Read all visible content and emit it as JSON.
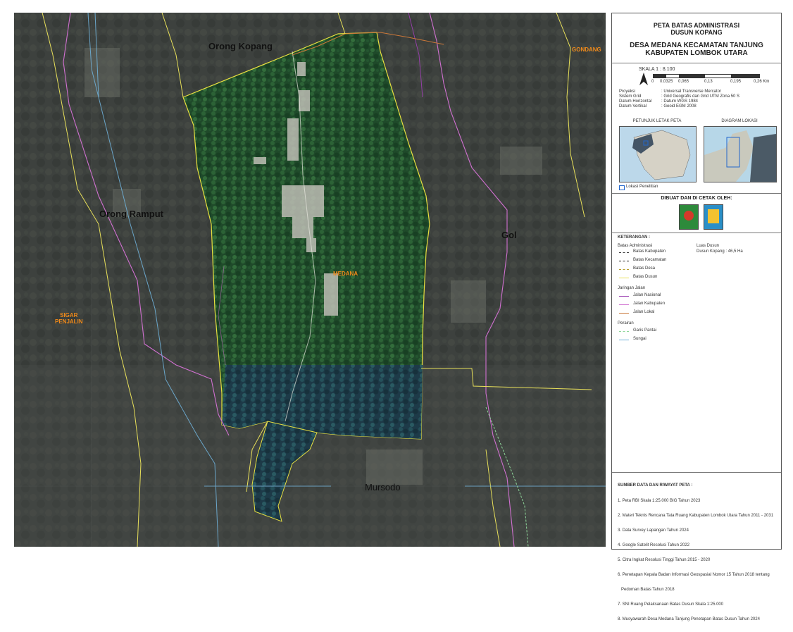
{
  "map": {
    "places": {
      "orong_kopang": "Orong Kopang",
      "orong_ramput": "Orong Ramput",
      "gol": "Gol",
      "mursodo": "Mursodo",
      "medana": "MEDANA",
      "sigar_penjalin": "SIGAR\nPENJALIN",
      "gondang": "GONDANG"
    },
    "colors": {
      "village_boundary": "#e8e040",
      "dusun_boundary": "#e8e05a",
      "kabupaten_road": "#d070d0",
      "national_road": "#9b3fb0",
      "local_road": "#c9773a",
      "river": "#6fb0d8",
      "coast": "#8fd89a"
    }
  },
  "panel": {
    "title1": "PETA BATAS ADMINISTRASI",
    "title2": "DUSUN KOPANG",
    "subtitle1": "DESA MEDANA KECAMATAN TANJUNG",
    "subtitle2": "KABUPATEN LOMBOK UTARA",
    "scale": "SKALA 1 : 8.100",
    "scale_ticks": [
      "0",
      "0,0325",
      "0,065",
      "0,13",
      "0,195",
      "0,26 Km"
    ],
    "proj_labels": [
      "Proyeksi",
      "Sistem Grid",
      "Datum Horizontal",
      "Datum Vertikal"
    ],
    "proj_values": [
      ": Universal Transverse Mercator",
      ": Grid Geografis dan Grid UTM Zona 50 S",
      ": Datum WGS 1984",
      ": Geoid EGM 2008"
    ],
    "inset_left_title": "PETUNJUK LETAK PETA",
    "inset_right_title": "DIAGRAM LOKASI",
    "inset_legend": "Lokasi Penelitian",
    "made_by": "DIBUAT DAN DI CETAK OLEH:",
    "legend_title": "KETERANGAN :",
    "legend_admin_header": "Batas Administrasi",
    "legend_admin": [
      "Batas Kabupaten",
      "Batas Kecamatan",
      "Batas Desa",
      "Batas Dusun"
    ],
    "legend_road_header": "Jaringan Jalan",
    "legend_roads": [
      "Jalan Nasional",
      "Jalan Kabupaten",
      "Jalan Lokal"
    ],
    "legend_water_header": "Perairan",
    "legend_water": [
      "Garis Pantai",
      "Sungai"
    ],
    "legend_area_header": "Luas Dusun",
    "legend_area_value": "Dusun Kopang : 46,5 Ha",
    "sources_title": "SUMBER DATA DAN RIWAYAT PETA :",
    "sources": [
      "1. Peta RBI Skala 1:25.000 BIG Tahun 2023",
      "2. Materi Teknis Rencana Tata Ruang Kabupaten Lombok Utara Tahun 2011 - 2031",
      "3. Data Survey Lapangan Tahun 2024",
      "4. Google Satelit Resolusi Tahun 2022",
      "5. Citra Ingkat Resolusi Tinggi Tahun 2015 - 2020",
      "6. Penetapan Kepala Badan Informasi Geospasial Nomor 15 Tahun 2018 tentang",
      "   Pedoman Batas Tahun 2018",
      "7. SNI Ruang Pelaksanaan Batas Dusun Skala 1:25.000",
      "8. Musyawarah Desa Medana Tanjung Penetapan Batas Dusun Tahun 2024"
    ]
  }
}
